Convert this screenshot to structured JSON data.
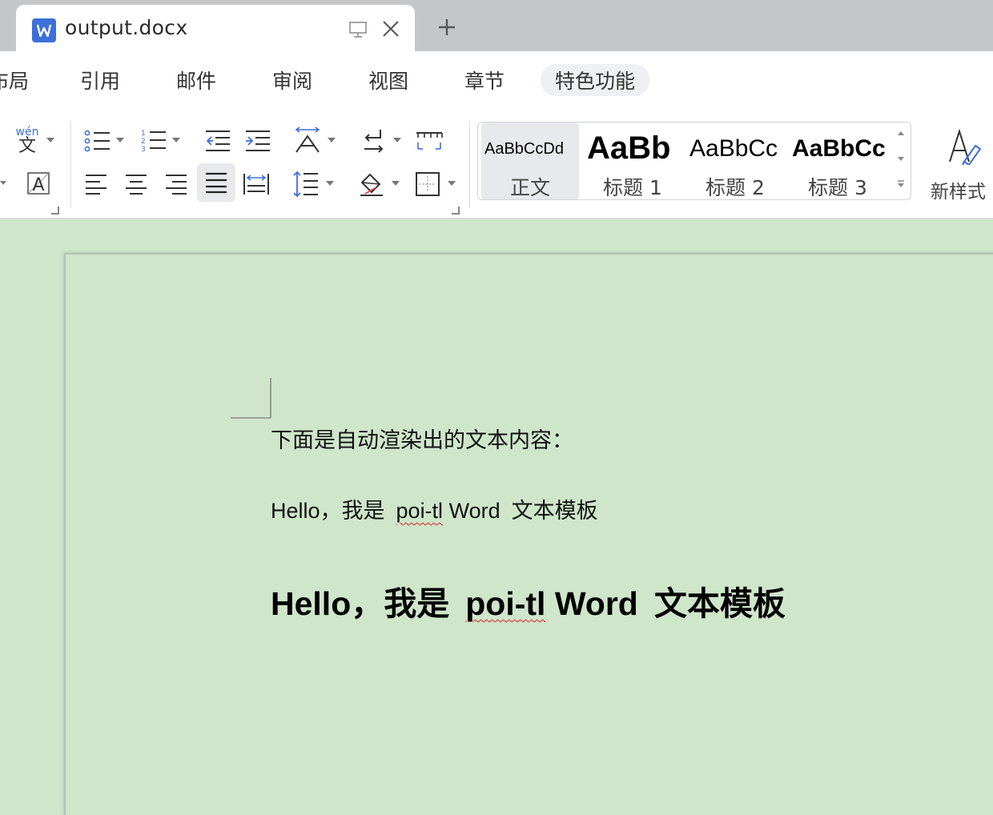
{
  "tab": {
    "title": "output.docx"
  },
  "menu": {
    "items": [
      {
        "label": "布局"
      },
      {
        "label": "引用"
      },
      {
        "label": "邮件"
      },
      {
        "label": "审阅"
      },
      {
        "label": "视图"
      },
      {
        "label": "章节"
      },
      {
        "label": "特色功能"
      }
    ]
  },
  "toolbar": {
    "pinyin_label": "wén",
    "pinyin_char": "文",
    "styles": [
      {
        "sample": "AaBbCcDd",
        "label": "正文"
      },
      {
        "sample": "AaBb",
        "label": "标题 1"
      },
      {
        "sample": "AaBbCc",
        "label": "标题 2"
      },
      {
        "sample": "AaBbCc",
        "label": "标题 3"
      }
    ],
    "new_style_label": "新样式"
  },
  "document": {
    "line1": "下面是自动渲染出的文本内容：",
    "line2": {
      "a": "Hello，我是",
      "b": "poi-tl",
      "c": "Word",
      "d": "文本模板"
    },
    "line3": {
      "a": "Hello，我是",
      "b": "poi-tl",
      "c": "Word",
      "d": "文本模板"
    }
  },
  "colors": {
    "accent_blue": "#3d6fd8",
    "page_bg": "#cfe6cb",
    "spell_error": "#e02020"
  }
}
